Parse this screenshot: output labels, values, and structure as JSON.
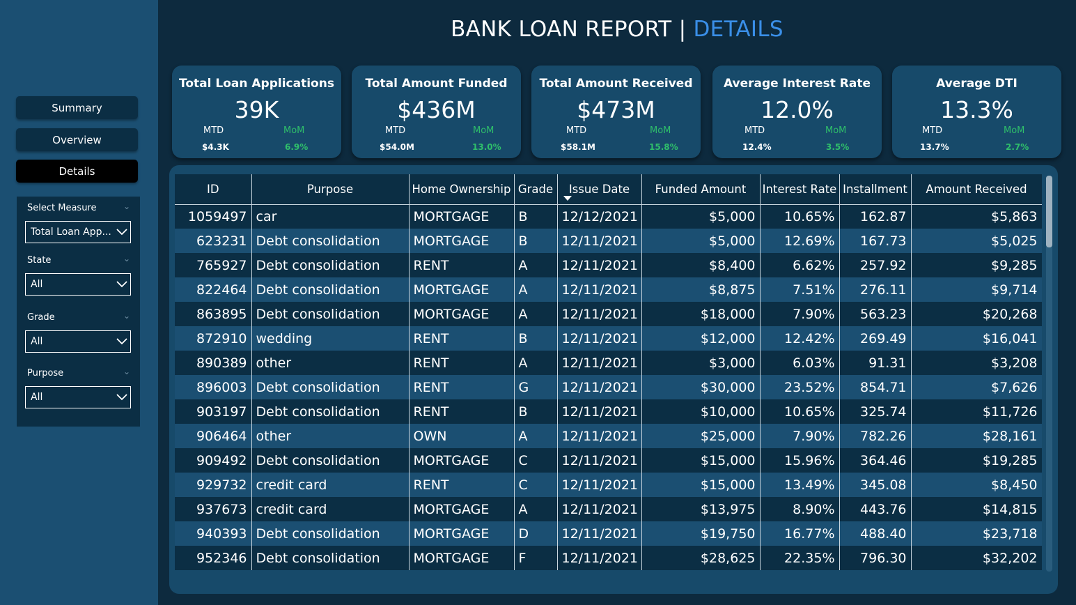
{
  "title": {
    "main": "BANK LOAN REPORT |",
    "accent": "DETAILS"
  },
  "nav": {
    "summary": "Summary",
    "overview": "Overview",
    "details": "Details"
  },
  "filters": {
    "measure": {
      "label": "Select Measure",
      "value": "Total Loan App..."
    },
    "state": {
      "label": "State",
      "value": "All"
    },
    "grade": {
      "label": "Grade",
      "value": "All"
    },
    "purpose": {
      "label": "Purpose",
      "value": "All"
    }
  },
  "kpis": [
    {
      "title": "Total Loan Applications",
      "value": "39K",
      "mtd_label": "MTD",
      "mtd_value": "$4.3K",
      "mom_label": "MoM",
      "mom_value": "6.9%"
    },
    {
      "title": "Total Amount Funded",
      "value": "$436M",
      "mtd_label": "MTD",
      "mtd_value": "$54.0M",
      "mom_label": "MoM",
      "mom_value": "13.0%"
    },
    {
      "title": "Total Amount Received",
      "value": "$473M",
      "mtd_label": "MTD",
      "mtd_value": "$58.1M",
      "mom_label": "MoM",
      "mom_value": "15.8%"
    },
    {
      "title": "Average Interest Rate",
      "value": "12.0%",
      "mtd_label": "MTD",
      "mtd_value": "12.4%",
      "mom_label": "MoM",
      "mom_value": "3.5%"
    },
    {
      "title": "Average DTI",
      "value": "13.3%",
      "mtd_label": "MTD",
      "mtd_value": "13.7%",
      "mom_label": "MoM",
      "mom_value": "2.7%"
    }
  ],
  "colors": {
    "accent": "#3a8fe8",
    "mom_green": "#2fbf6a",
    "panel": "#174a6a",
    "background": "#0d2a3e"
  },
  "table": {
    "columns": [
      "ID",
      "Purpose",
      "Home Ownership",
      "Grade",
      "Issue Date",
      "Funded Amount",
      "Interest Rate",
      "Installment",
      "Amount Received"
    ],
    "rows": [
      [
        "1059497",
        "car",
        "MORTGAGE",
        "B",
        "12/12/2021",
        "$5,000",
        "10.65%",
        "162.87",
        "$5,863"
      ],
      [
        "623231",
        "Debt consolidation",
        "MORTGAGE",
        "B",
        "12/11/2021",
        "$5,000",
        "12.69%",
        "167.73",
        "$5,025"
      ],
      [
        "765927",
        "Debt consolidation",
        "RENT",
        "A",
        "12/11/2021",
        "$8,400",
        "6.62%",
        "257.92",
        "$9,285"
      ],
      [
        "822464",
        "Debt consolidation",
        "MORTGAGE",
        "A",
        "12/11/2021",
        "$8,875",
        "7.51%",
        "276.11",
        "$9,714"
      ],
      [
        "863895",
        "Debt consolidation",
        "MORTGAGE",
        "A",
        "12/11/2021",
        "$18,000",
        "7.90%",
        "563.23",
        "$20,268"
      ],
      [
        "872910",
        "wedding",
        "RENT",
        "B",
        "12/11/2021",
        "$12,000",
        "12.42%",
        "269.49",
        "$16,041"
      ],
      [
        "890389",
        "other",
        "RENT",
        "A",
        "12/11/2021",
        "$3,000",
        "6.03%",
        "91.31",
        "$3,208"
      ],
      [
        "896003",
        "Debt consolidation",
        "RENT",
        "G",
        "12/11/2021",
        "$30,000",
        "23.52%",
        "854.71",
        "$7,626"
      ],
      [
        "903197",
        "Debt consolidation",
        "RENT",
        "B",
        "12/11/2021",
        "$10,000",
        "10.65%",
        "325.74",
        "$11,726"
      ],
      [
        "906464",
        "other",
        "OWN",
        "A",
        "12/11/2021",
        "$25,000",
        "7.90%",
        "782.26",
        "$28,161"
      ],
      [
        "909492",
        "Debt consolidation",
        "MORTGAGE",
        "C",
        "12/11/2021",
        "$15,000",
        "15.96%",
        "364.46",
        "$19,285"
      ],
      [
        "929732",
        "credit card",
        "RENT",
        "C",
        "12/11/2021",
        "$15,000",
        "13.49%",
        "345.08",
        "$8,450"
      ],
      [
        "937673",
        "credit card",
        "MORTGAGE",
        "A",
        "12/11/2021",
        "$13,975",
        "8.90%",
        "443.76",
        "$14,815"
      ],
      [
        "940393",
        "Debt consolidation",
        "MORTGAGE",
        "D",
        "12/11/2021",
        "$19,750",
        "16.77%",
        "488.40",
        "$23,718"
      ],
      [
        "952346",
        "Debt consolidation",
        "MORTGAGE",
        "F",
        "12/11/2021",
        "$28,625",
        "22.35%",
        "796.30",
        "$32,202"
      ]
    ]
  }
}
